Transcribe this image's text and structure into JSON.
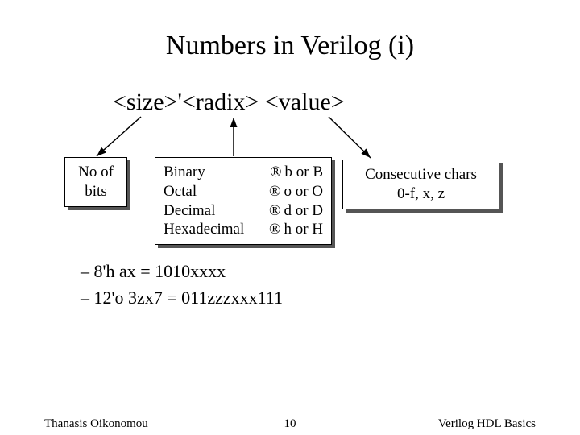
{
  "title": "Numbers in Verilog (i)",
  "syntax": {
    "size": "<size>",
    "tick": "'",
    "radix": "<radix>",
    "space": " ",
    "value": "<value>"
  },
  "bits_box": {
    "line1": "No of",
    "line2": "bits"
  },
  "radix_box": {
    "rows": [
      {
        "name": "Binary",
        "arrow": "®",
        "code": "b or B"
      },
      {
        "name": "Octal",
        "arrow": "®",
        "code": "o or O"
      },
      {
        "name": "Decimal",
        "arrow": "®",
        "code": "d or D"
      },
      {
        "name": "Hexadecimal",
        "arrow": "®",
        "code": "h or H"
      }
    ]
  },
  "value_box": {
    "line1": "Consecutive chars",
    "line2": "0-f, x, z"
  },
  "examples": [
    "8'h ax = 1010xxxx",
    "12'o 3zx7 = 011zzzxxx111"
  ],
  "footer": {
    "left": "Thanasis Oikonomou",
    "center": "10",
    "right": "Verilog HDL Basics"
  }
}
